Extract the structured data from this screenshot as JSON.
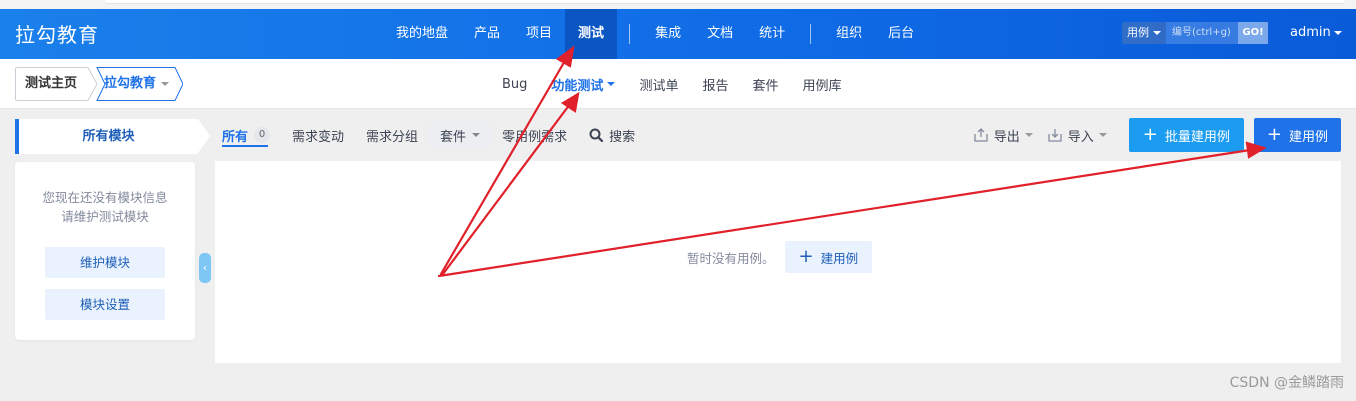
{
  "header": {
    "brand": "拉勾教育",
    "nav": [
      "我的地盘",
      "产品",
      "项目",
      "测试",
      "集成",
      "文档",
      "统计",
      "组织",
      "后台"
    ],
    "search": {
      "type": "用例",
      "placeholder": "编号(ctrl+g)",
      "go": "GO!"
    },
    "user": "admin"
  },
  "breadcrumb": {
    "home": "测试主页",
    "current": "拉勾教育"
  },
  "subnav": [
    "Bug",
    "功能测试",
    "测试单",
    "报告",
    "套件",
    "用例库"
  ],
  "sidebar": {
    "tab": "所有模块",
    "message_line1": "您现在还没有模块信息",
    "message_line2": "请维护测试模块",
    "maintain_button": "维护模块",
    "settings_button": "模块设置"
  },
  "toolbar": {
    "all": "所有",
    "all_count": "0",
    "changed": "需求变动",
    "group": "需求分组",
    "suite": "套件",
    "zero": "零用例需求",
    "search": "搜索"
  },
  "actions": {
    "export": "导出",
    "import": "导入",
    "batch_create": "批量建用例",
    "create": "建用例"
  },
  "empty": {
    "message": "暂时没有用例。",
    "create": "建用例"
  },
  "watermark": "CSDN @金鳞踏雨",
  "colors": {
    "header": "#1a80ea",
    "accent": "#1f72e8",
    "annotation": "#e0202a"
  }
}
